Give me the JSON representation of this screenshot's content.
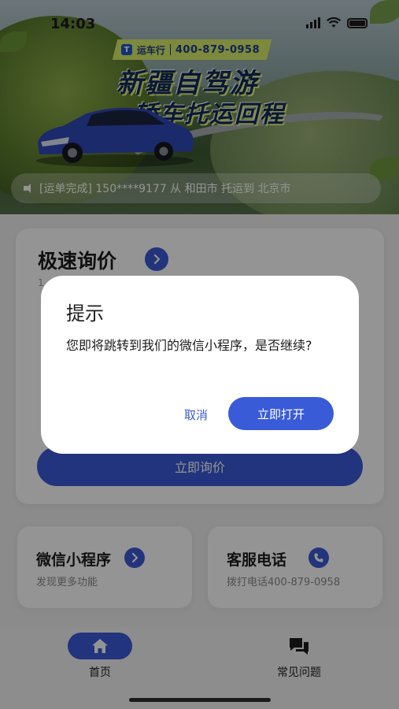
{
  "status_bar": {
    "time": "14:03"
  },
  "banner": {
    "brand_name": "运车行",
    "phone": "400-879-0958",
    "title": "新疆自驾游",
    "subtitle": "轿车托运回程",
    "ticker": "[运单完成] 150****9177 从 和田市 托运到 北京市"
  },
  "quote_card": {
    "title": "极速询价",
    "hint": "1",
    "submit_label": "立即询价"
  },
  "mini_cards": {
    "miniprogram": {
      "title": "微信小程序",
      "subtitle": "发现更多功能"
    },
    "service": {
      "title": "客服电话",
      "subtitle": "拨打电话400-879-0958"
    }
  },
  "tabbar": {
    "home_label": "首页",
    "faq_label": "常见问题"
  },
  "dialog": {
    "title": "提示",
    "message": "您即将跳转到我们的微信小程序，是否继续?",
    "cancel_label": "取消",
    "confirm_label": "立即打开"
  },
  "colors": {
    "accent": "#3a5bd8",
    "overlay": "rgba(0,0,0,0.42)",
    "badge": "#d8ec6a"
  },
  "icons": [
    "speaker-icon",
    "chevron-right-icon",
    "phone-icon",
    "home-icon",
    "chat-bubbles-icon",
    "signal-icon",
    "wifi-icon",
    "battery-icon"
  ]
}
